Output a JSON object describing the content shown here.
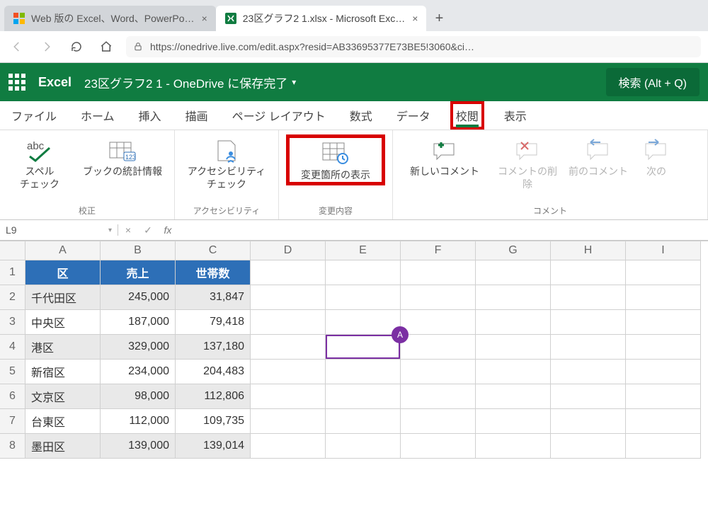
{
  "browser": {
    "tabs": [
      {
        "title": "Web 版の Excel、Word、PowerPo…"
      },
      {
        "title": "23区グラフ2 1.xlsx - Microsoft Exc…"
      }
    ],
    "url": "https://onedrive.live.com/edit.aspx?resid=AB33695377E73BE5!3060&ci…"
  },
  "excel_header": {
    "app_name": "Excel",
    "doc_status": "23区グラフ2 1 - OneDrive に保存完了",
    "search_label": "検索 (Alt + Q)"
  },
  "ribbon_tabs": [
    "ファイル",
    "ホーム",
    "挿入",
    "描画",
    "ページ レイアウト",
    "数式",
    "データ",
    "校閲",
    "表示"
  ],
  "active_ribbon_tab": "校閲",
  "ribbon": {
    "groups": [
      {
        "name": "校正",
        "buttons": [
          {
            "id": "spell-check",
            "label": "スペル\nチェック"
          },
          {
            "id": "workbook-stats",
            "label": "ブックの統計情報"
          }
        ]
      },
      {
        "name": "アクセシビリティ",
        "buttons": [
          {
            "id": "accessibility-check",
            "label": "アクセシビリティ\nチェック"
          }
        ]
      },
      {
        "name": "変更内容",
        "buttons": [
          {
            "id": "show-changes",
            "label": "変更箇所の表示"
          }
        ]
      },
      {
        "name": "コメント",
        "buttons": [
          {
            "id": "new-comment",
            "label": "新しいコメント"
          },
          {
            "id": "delete-comment",
            "label": "コメントの削除",
            "disabled": true
          },
          {
            "id": "prev-comment",
            "label": "前のコメント",
            "disabled": true
          },
          {
            "id": "next-comment",
            "label": "次の",
            "disabled": true
          }
        ]
      }
    ]
  },
  "formula_bar": {
    "name_box": "L9"
  },
  "sheet": {
    "columns": [
      "A",
      "B",
      "C",
      "D",
      "E",
      "F",
      "G",
      "H",
      "I"
    ],
    "rows": [
      1,
      2,
      3,
      4,
      5,
      6,
      7,
      8
    ],
    "header_row": {
      "A": "区",
      "B": "売上",
      "C": "世帯数"
    },
    "data": [
      {
        "A": "千代田区",
        "B": "245,000",
        "C": "31,847",
        "band": true
      },
      {
        "A": "中央区",
        "B": "187,000",
        "C": "79,418",
        "band": false
      },
      {
        "A": "港区",
        "B": "329,000",
        "C": "137,180",
        "band": true
      },
      {
        "A": "新宿区",
        "B": "234,000",
        "C": "204,483",
        "band": false
      },
      {
        "A": "文京区",
        "B": "98,000",
        "C": "112,806",
        "band": true
      },
      {
        "A": "台東区",
        "B": "112,000",
        "C": "109,735",
        "band": false
      },
      {
        "A": "墨田区",
        "B": "139,000",
        "C": "139,014",
        "band": true
      }
    ],
    "presence_cell": "E4",
    "presence_initial": "A"
  }
}
